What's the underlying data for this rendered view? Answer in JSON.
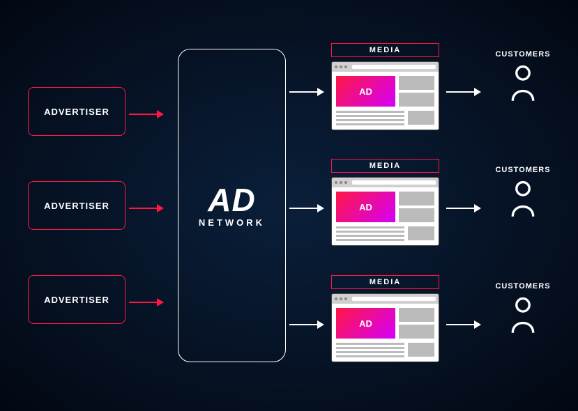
{
  "advertisers": [
    {
      "label": "ADVERTISER"
    },
    {
      "label": "ADVERTISER"
    },
    {
      "label": "ADVERTISER"
    }
  ],
  "network": {
    "title": "AD",
    "subtitle": "NETWORK"
  },
  "media": [
    {
      "label": "MEDIA",
      "ad_text": "AD"
    },
    {
      "label": "MEDIA",
      "ad_text": "AD"
    },
    {
      "label": "MEDIA",
      "ad_text": "AD"
    }
  ],
  "customers": [
    {
      "label": "CUSTOMERS"
    },
    {
      "label": "CUSTOMERS"
    },
    {
      "label": "CUSTOMERS"
    }
  ]
}
